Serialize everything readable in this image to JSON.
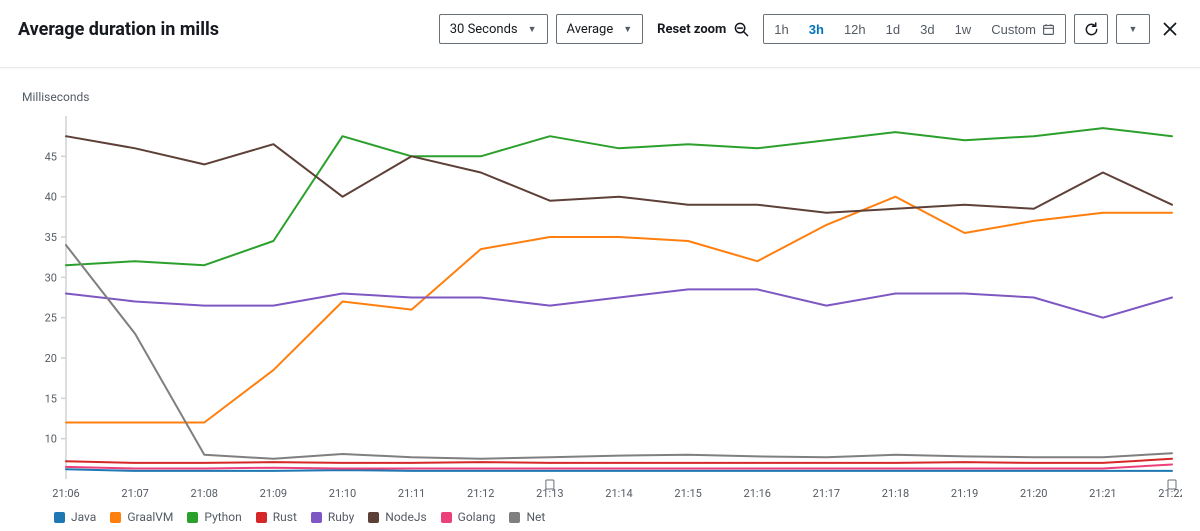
{
  "header": {
    "title": "Average duration in mills",
    "period_select": "30 Seconds",
    "stat_select": "Average",
    "reset_zoom_label": "Reset zoom",
    "time_range": {
      "options": [
        "1h",
        "3h",
        "12h",
        "1d",
        "3d",
        "1w"
      ],
      "active": "3h",
      "custom_label": "Custom"
    }
  },
  "chart_data": {
    "type": "line",
    "ylabel": "Milliseconds",
    "xlabel": "",
    "ylim": [
      5,
      50
    ],
    "y_ticks": [
      10,
      15,
      20,
      25,
      30,
      35,
      40,
      45
    ],
    "x_labels": [
      "21:06",
      "21:07",
      "21:08",
      "21:09",
      "21:10",
      "21:11",
      "21:12",
      "21:13",
      "21:14",
      "21:15",
      "21:16",
      "21:17",
      "21:18",
      "21:19",
      "21:20",
      "21:21",
      "21:22"
    ],
    "categories": [
      "21:06",
      "21:07",
      "21:08",
      "21:09",
      "21:10",
      "21:11",
      "21:12",
      "21:13",
      "21:14",
      "21:15",
      "21:16",
      "21:17",
      "21:18",
      "21:19",
      "21:20",
      "21:21",
      "21:22"
    ],
    "series": [
      {
        "name": "Java",
        "color": "#1f77b4",
        "values": [
          6.2,
          6.0,
          6.0,
          6.0,
          6.1,
          6.0,
          6.0,
          6.0,
          6.0,
          6.0,
          6.0,
          6.0,
          6.0,
          6.0,
          6.0,
          6.0,
          6.0
        ]
      },
      {
        "name": "GraalVM",
        "color": "#ff7f0e",
        "values": [
          12,
          12,
          12,
          18.5,
          27,
          26,
          33.5,
          35,
          35,
          34.5,
          32,
          36.5,
          40,
          35.5,
          37,
          38,
          38
        ]
      },
      {
        "name": "Python",
        "color": "#2ca02c",
        "values": [
          31.5,
          32,
          31.5,
          34.5,
          47.5,
          45,
          45,
          47.5,
          46,
          46.5,
          46,
          47,
          48,
          47,
          47.5,
          48.5,
          47.5
        ]
      },
      {
        "name": "Rust",
        "color": "#d62728",
        "values": [
          7.2,
          7.0,
          7.0,
          7.1,
          7.0,
          7.0,
          7.1,
          7.0,
          7.0,
          7.0,
          7.0,
          7.0,
          7.0,
          7.1,
          7.0,
          7.0,
          7.5
        ]
      },
      {
        "name": "Ruby",
        "color": "#7e57c2",
        "values": [
          28,
          27,
          26.5,
          26.5,
          28,
          27.5,
          27.5,
          26.5,
          27.5,
          28.5,
          28.5,
          26.5,
          28,
          28,
          27.5,
          25,
          27.5
        ]
      },
      {
        "name": "NodeJs",
        "color": "#5d4037",
        "values": [
          47.5,
          46,
          44,
          46.5,
          40,
          45,
          43,
          39.5,
          40,
          39,
          39,
          38,
          38.5,
          39,
          38.5,
          43,
          39
        ]
      },
      {
        "name": "Golang",
        "color": "#ec407a",
        "values": [
          6.5,
          6.3,
          6.3,
          6.4,
          6.3,
          6.3,
          6.3,
          6.3,
          6.3,
          6.3,
          6.3,
          6.3,
          6.3,
          6.3,
          6.3,
          6.3,
          6.8
        ]
      },
      {
        "name": "Net",
        "color": "#7f7f7f",
        "values": [
          34,
          23,
          8,
          7.5,
          8.1,
          7.7,
          7.5,
          7.7,
          7.9,
          8,
          7.8,
          7.7,
          8,
          7.8,
          7.7,
          7.7,
          8.2
        ]
      }
    ]
  }
}
